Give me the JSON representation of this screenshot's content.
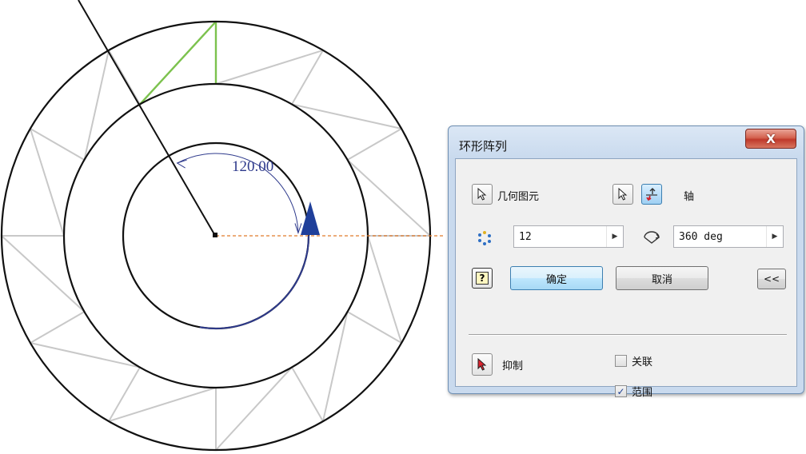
{
  "drawing": {
    "angle_dimension": "120.00",
    "colors": {
      "outline": "#111111",
      "construction": "#c8c8c8",
      "selected_profile": "#7cc24e",
      "axis_line": "#e07a2a",
      "dimension": "#2e3a8c",
      "direction_arrow": "#1f3f9a"
    }
  },
  "dialog": {
    "title": "环形阵列",
    "close_label": "X",
    "geometry_label": "几何图元",
    "axis_label": "轴",
    "count_value": "12",
    "angle_value": "360 deg",
    "ok_label": "确定",
    "cancel_label": "取消",
    "more_label": "<<",
    "help_label": "?",
    "suppress_label": "抑制",
    "associative_label": "关联",
    "associative_checked": false,
    "fitted_label": "范围",
    "fitted_checked": true
  }
}
